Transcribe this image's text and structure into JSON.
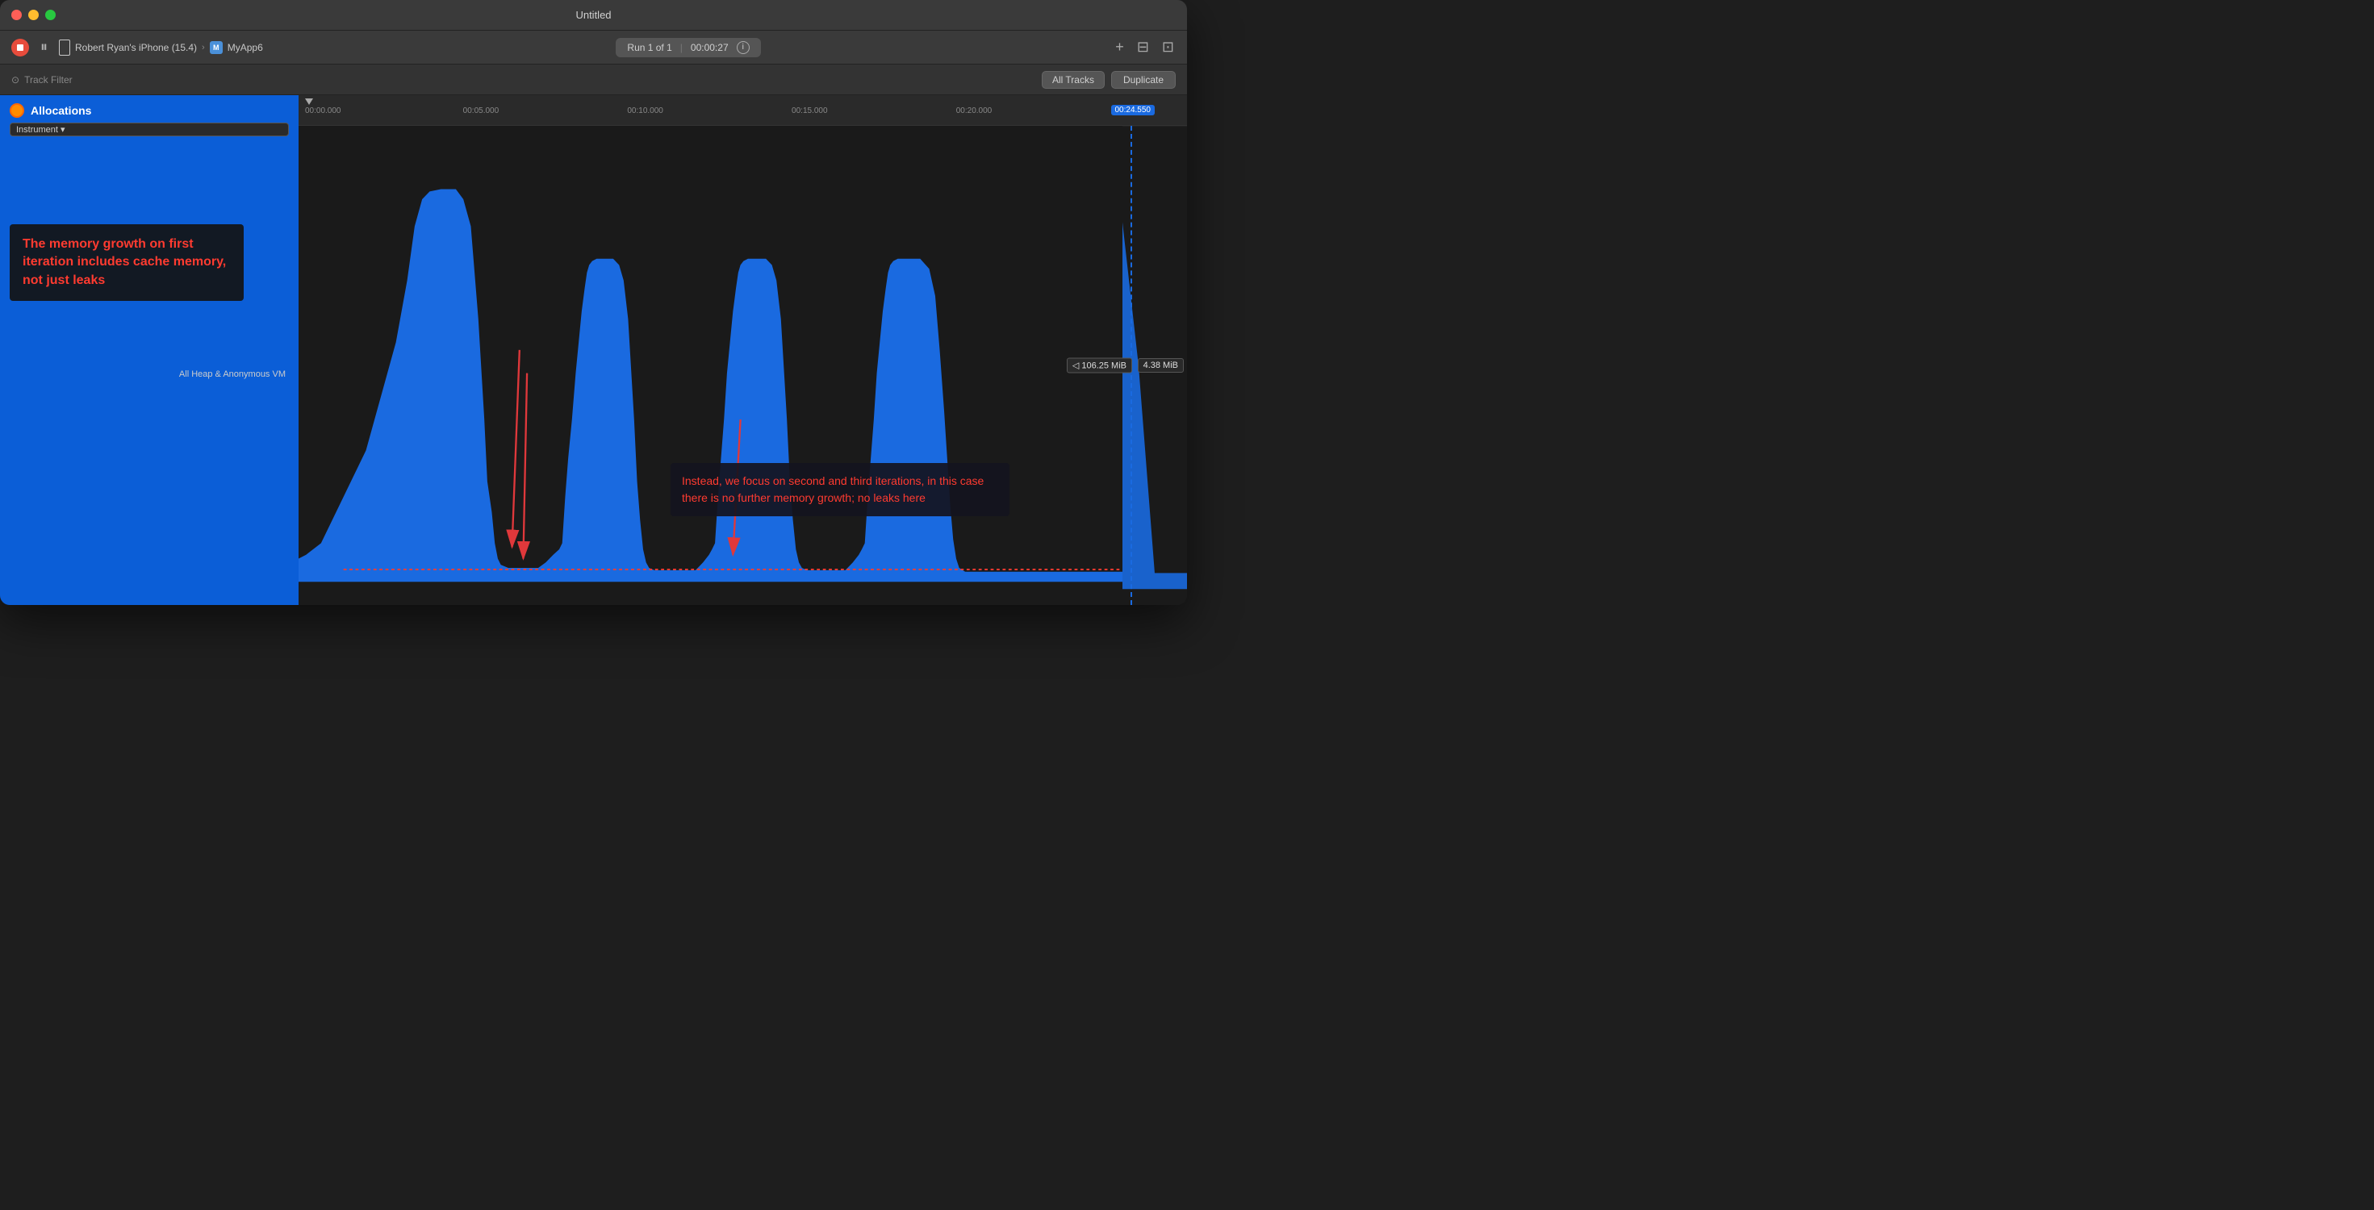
{
  "window": {
    "title": "Untitled"
  },
  "traffic_lights": {
    "close": "close",
    "minimize": "minimize",
    "maximize": "maximize"
  },
  "toolbar": {
    "device_name": "Robert Ryan's iPhone (15.4)",
    "chevron": "›",
    "app_name": "MyApp6",
    "run_label": "Run 1 of 1",
    "divider": "|",
    "run_time": "00:00:27",
    "add_label": "+",
    "layout1_label": "⊟",
    "layout2_label": "⊡"
  },
  "filter_bar": {
    "filter_icon": "⊙",
    "filter_placeholder": "Track Filter",
    "all_tracks_label": "All Tracks",
    "duplicate_label": "Duplicate"
  },
  "sidebar": {
    "track_name": "Allocations",
    "instrument_badge": "Instrument ▾",
    "heap_label": "All Heap & Anonymous VM",
    "annotation1": {
      "text": "The memory growth on first iteration includes cache memory, not just leaks"
    }
  },
  "timeline": {
    "ticks": [
      {
        "label": "00:00.000",
        "pct": 0
      },
      {
        "label": "00:05.000",
        "pct": 18.5
      },
      {
        "label": "00:10.000",
        "pct": 37
      },
      {
        "label": "00:15.000",
        "pct": 55.5
      },
      {
        "label": "00:20.000",
        "pct": 74
      },
      {
        "label": "00:24.550",
        "pct": 89,
        "current": true
      }
    ]
  },
  "chart": {
    "value_label_left": "◁ 106.25 MiB",
    "value_label_right": "4.38 MiB",
    "annotation2": {
      "text": "Instead, we focus on second and third iterations, in this case there is no further memory growth; no leaks here"
    }
  },
  "colors": {
    "blue_fill": "#1a6ae0",
    "background": "#2b2b2b",
    "chart_bg": "#1a1a1a",
    "red_annotation": "#ff3b30",
    "sidebar_bg": "#0b5ed7",
    "current_time_line": "#1a6ae0"
  }
}
